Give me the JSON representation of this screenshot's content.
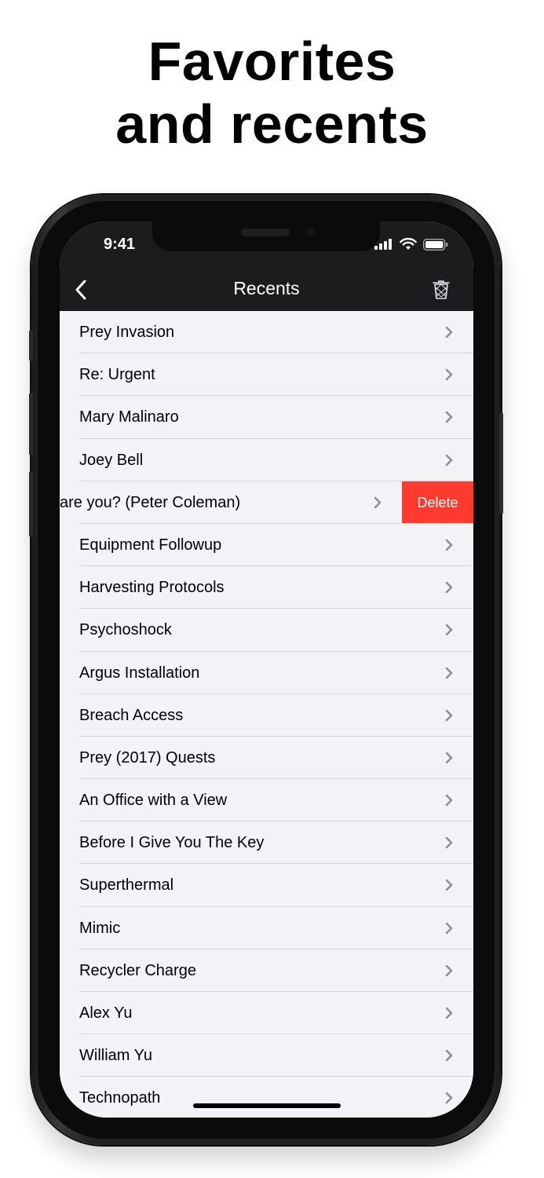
{
  "headline": {
    "line1": "Favorites",
    "line2": "and recents"
  },
  "status_bar": {
    "time": "9:41",
    "icons": [
      "cellular-signal-icon",
      "wifi-icon",
      "battery-icon"
    ]
  },
  "nav": {
    "title": "Recents",
    "back_icon": "chevron-left-icon",
    "trash_icon": "trash-icon"
  },
  "list": {
    "items": [
      {
        "label": "Prey Invasion"
      },
      {
        "label": "Re: Urgent"
      },
      {
        "label": "Mary Malinaro"
      },
      {
        "label": "Joey Bell"
      },
      {
        "label": "are you? (Peter Coleman)",
        "swiped": true
      },
      {
        "label": "Equipment Followup"
      },
      {
        "label": "Harvesting Protocols"
      },
      {
        "label": "Psychoshock"
      },
      {
        "label": "Argus Installation"
      },
      {
        "label": "Breach Access"
      },
      {
        "label": "Prey (2017) Quests"
      },
      {
        "label": "An Office with a View"
      },
      {
        "label": "Before I Give You The Key"
      },
      {
        "label": "Superthermal"
      },
      {
        "label": "Mimic"
      },
      {
        "label": "Recycler Charge"
      },
      {
        "label": "Alex Yu"
      },
      {
        "label": "William Yu"
      },
      {
        "label": "Technopath"
      }
    ],
    "delete_label": "Delete"
  },
  "colors": {
    "bar_background": "#1c1c1e",
    "list_background": "#f2f2f7",
    "delete": "#ff3b30",
    "chevron": "#8e8e93"
  }
}
